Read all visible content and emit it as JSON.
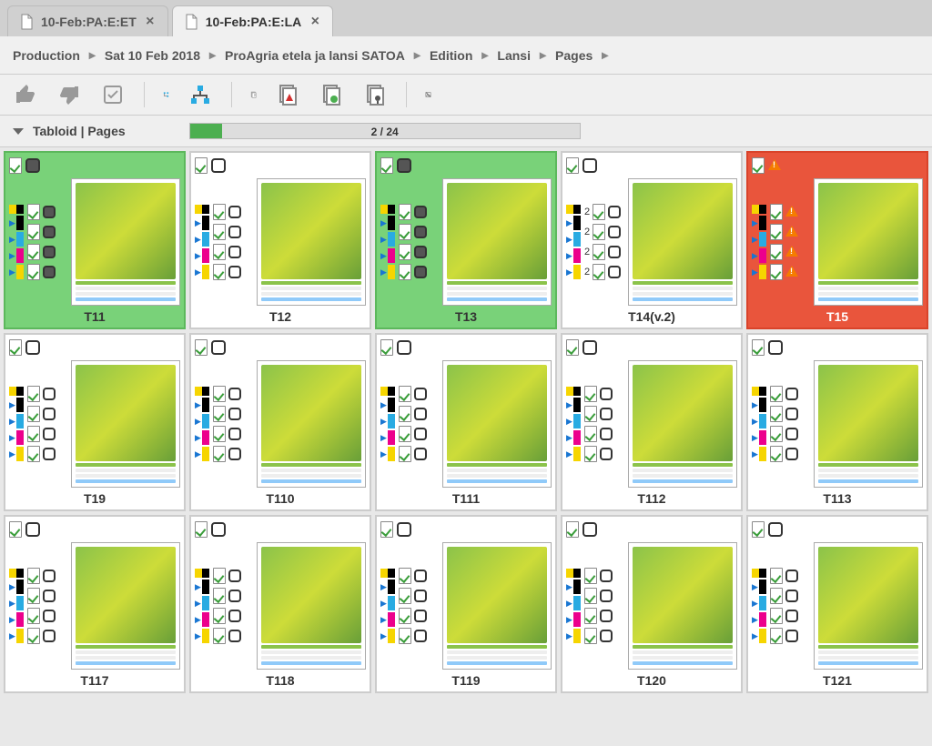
{
  "tabs": [
    {
      "label": "10-Feb:PA:E:ET",
      "active": false
    },
    {
      "label": "10-Feb:PA:E:LA",
      "active": true
    }
  ],
  "breadcrumb": [
    "Production",
    "Sat 10 Feb 2018",
    "ProAgria etela ja lansi SATOA",
    "Edition",
    "Lansi",
    "Pages"
  ],
  "section": {
    "title": "Tabloid | Pages",
    "progress_text": "2 / 24",
    "progress_pct": 8.3
  },
  "pages": [
    {
      "label": "T11",
      "status": "green",
      "header_check": "filled",
      "row_check": "filled",
      "row_mark": "check"
    },
    {
      "label": "T12",
      "status": "white",
      "header_check": "empty",
      "row_check": "empty",
      "row_mark": "check"
    },
    {
      "label": "T13",
      "status": "green",
      "header_check": "filled",
      "row_check": "filled",
      "row_mark": "check"
    },
    {
      "label": "T14(v.2)",
      "status": "white",
      "header_check": "empty",
      "row_check": "empty",
      "row_mark": "check",
      "row_text": "2"
    },
    {
      "label": "T15",
      "status": "red",
      "header_check": "warn",
      "row_check": "warn",
      "row_mark": "check"
    },
    {
      "label": "T19",
      "status": "white",
      "header_check": "empty",
      "row_check": "empty",
      "row_mark": "check"
    },
    {
      "label": "T110",
      "status": "white",
      "header_check": "empty",
      "row_check": "empty",
      "row_mark": "check"
    },
    {
      "label": "T111",
      "status": "white",
      "header_check": "empty",
      "row_check": "empty",
      "row_mark": "check"
    },
    {
      "label": "T112",
      "status": "white",
      "header_check": "empty",
      "row_check": "empty",
      "row_mark": "check"
    },
    {
      "label": "T113",
      "status": "white",
      "header_check": "empty",
      "row_check": "empty",
      "row_mark": "check"
    },
    {
      "label": "T117",
      "status": "white",
      "header_check": "empty",
      "row_check": "empty",
      "row_mark": "check"
    },
    {
      "label": "T118",
      "status": "white",
      "header_check": "empty",
      "row_check": "empty",
      "row_mark": "check"
    },
    {
      "label": "T119",
      "status": "white",
      "header_check": "empty",
      "row_check": "empty",
      "row_mark": "check"
    },
    {
      "label": "T120",
      "status": "white",
      "header_check": "empty",
      "row_check": "empty",
      "row_mark": "check"
    },
    {
      "label": "T121",
      "status": "white",
      "header_check": "empty",
      "row_check": "empty",
      "row_mark": "check"
    }
  ],
  "cmyk": [
    "y",
    "k",
    "c",
    "m"
  ]
}
